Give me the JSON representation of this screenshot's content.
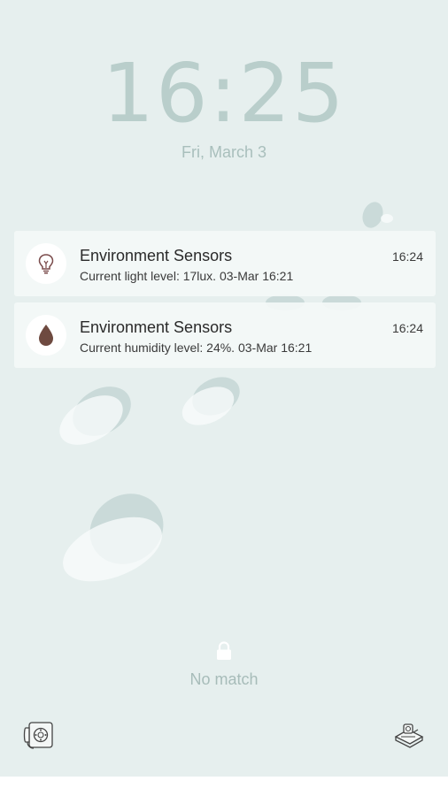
{
  "lockscreen": {
    "time": "16:25",
    "date": "Fri, March 3",
    "unlock_status": "No match"
  },
  "notifications": [
    {
      "app": "Environment Sensors",
      "text": "Current light level: 17lux. 03-Mar 16:21",
      "time": "16:24",
      "icon": "lightbulb-icon",
      "icon_color": "#7a4b4b"
    },
    {
      "app": "Environment Sensors",
      "text": "Current humidity level: 24%. 03-Mar 16:21",
      "time": "16:24",
      "icon": "water-drop-icon",
      "icon_color": "#6e4a40"
    }
  ],
  "shortcuts": {
    "left": "phone-icon",
    "right": "camera-icon"
  },
  "colors": {
    "wallpaper": "#e6efee",
    "clock_text": "#b9cecb"
  }
}
